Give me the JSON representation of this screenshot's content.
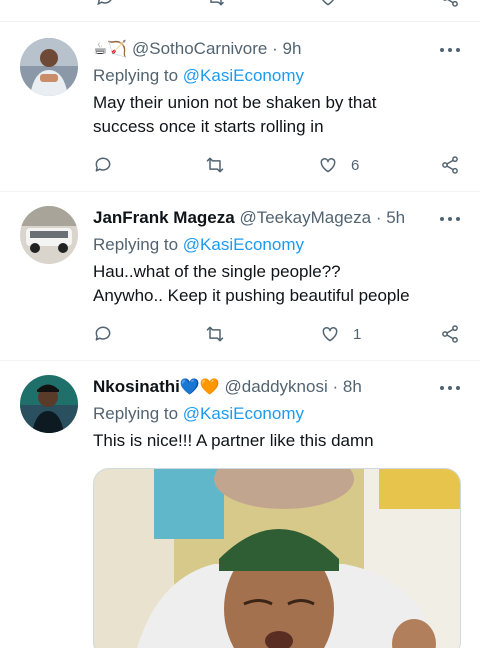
{
  "top_strip": {
    "description": "action bar of previous tweet (cut off)"
  },
  "tweets": [
    {
      "prefix_emojis": "☕🏹",
      "name": "",
      "handle": "@SothoCarnivore",
      "separator": "·",
      "time": "9h",
      "replying_label": "Replying to",
      "replying_to": "@KasiEconomy",
      "text_lines": [
        "May their union not be shaken by that",
        "success once it starts rolling in"
      ],
      "like_count": "6"
    },
    {
      "name": "JanFrank Mageza",
      "handle": "@TeekayMageza",
      "separator": "·",
      "time": "5h",
      "replying_label": "Replying to",
      "replying_to": "@KasiEconomy",
      "text_lines": [
        "Hau..what of the single people??",
        "Anywho.. Keep it pushing beautiful people"
      ],
      "like_count": "1"
    },
    {
      "name": "Nkosinathi",
      "name_emojis": "💙🧡",
      "handle": "@daddyknosi",
      "separator": "·",
      "time": "8h",
      "replying_label": "Replying to",
      "replying_to": "@KasiEconomy",
      "text_lines": [
        "This is nice!!! A partner like this damn"
      ]
    }
  ],
  "icons": {
    "reply": "speech-bubble-icon",
    "retweet": "retweet-icon",
    "like": "heart-icon",
    "share": "share-icon",
    "more": "more-dots-icon"
  },
  "colors": {
    "accent": "#1d9bf0",
    "secondary_text": "#536471",
    "border": "#eff3f4"
  }
}
